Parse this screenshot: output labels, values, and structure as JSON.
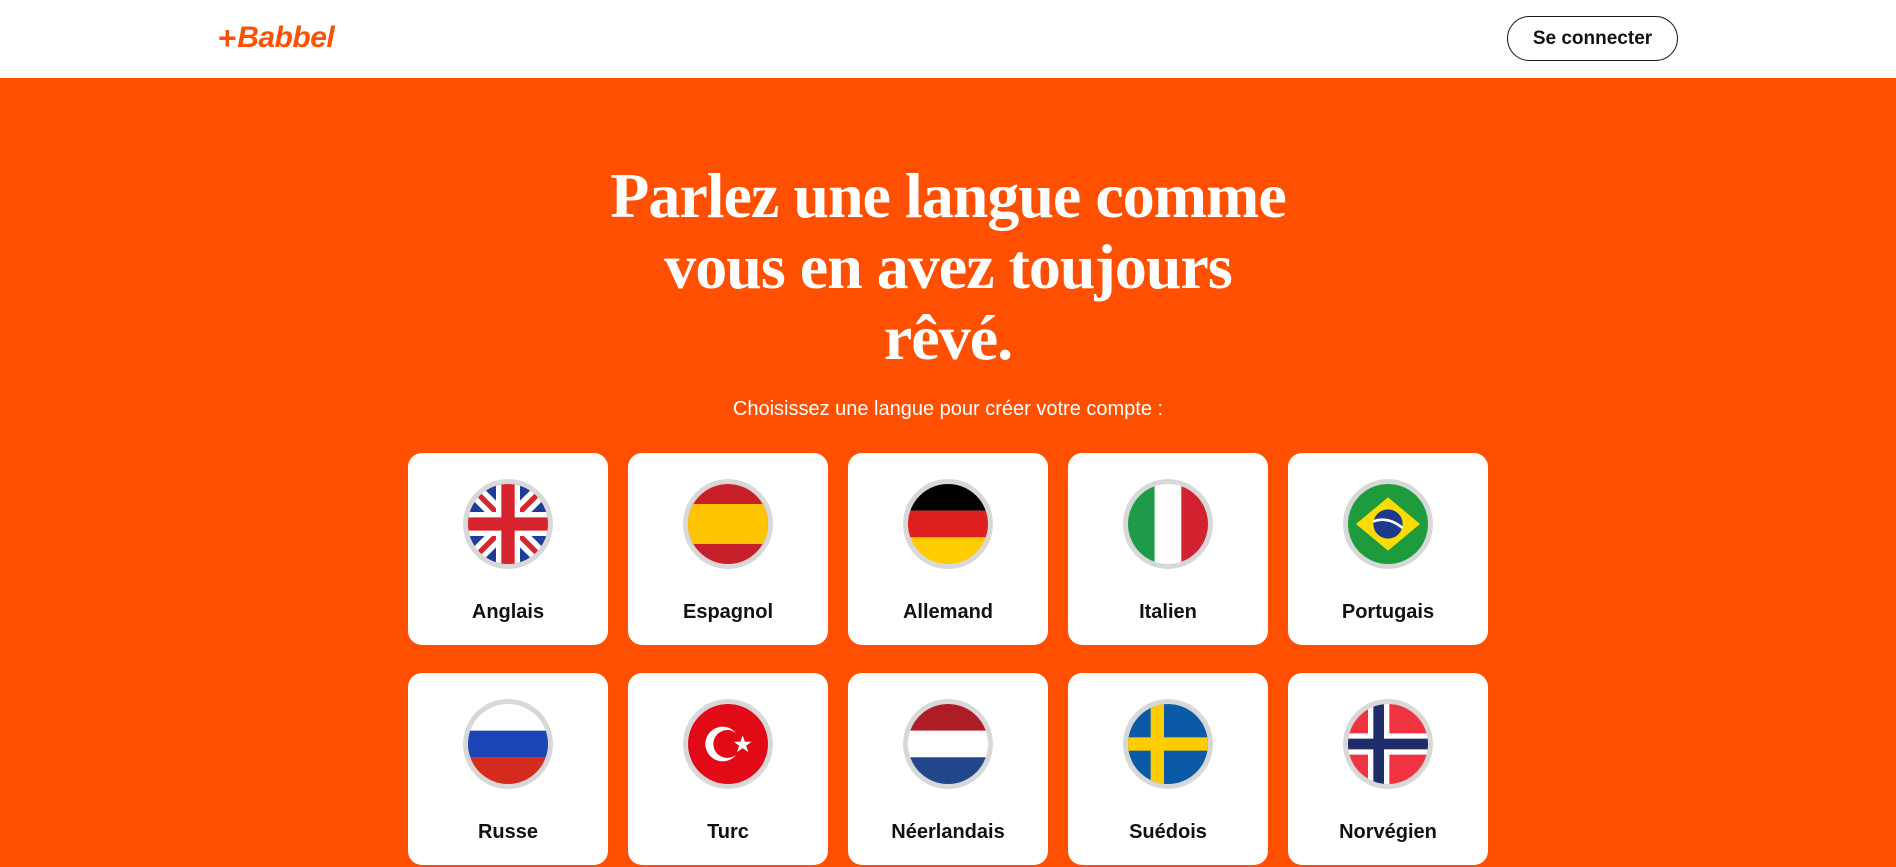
{
  "header": {
    "logo_plus": "+",
    "logo_text": "Babbel",
    "login_label": "Se connecter"
  },
  "hero": {
    "headline_line1": "Parlez une langue comme",
    "headline_line2": "vous en avez toujours",
    "headline_line3": "rêvé.",
    "subtitle": "Choisissez une langue pour créer votre compte :"
  },
  "languages": [
    {
      "label": "Anglais",
      "flag": "uk-flag-icon"
    },
    {
      "label": "Espagnol",
      "flag": "spain-flag-icon"
    },
    {
      "label": "Allemand",
      "flag": "germany-flag-icon"
    },
    {
      "label": "Italien",
      "flag": "italy-flag-icon"
    },
    {
      "label": "Portugais",
      "flag": "brazil-flag-icon"
    },
    {
      "label": "Russe",
      "flag": "russia-flag-icon"
    },
    {
      "label": "Turc",
      "flag": "turkey-flag-icon"
    },
    {
      "label": "Néerlandais",
      "flag": "netherlands-flag-icon"
    },
    {
      "label": "Suédois",
      "flag": "sweden-flag-icon"
    },
    {
      "label": "Norvégien",
      "flag": "norway-flag-icon"
    }
  ],
  "colors": {
    "brand": "#ff4f00",
    "card_bg": "#ffffff",
    "text": "#111111"
  }
}
